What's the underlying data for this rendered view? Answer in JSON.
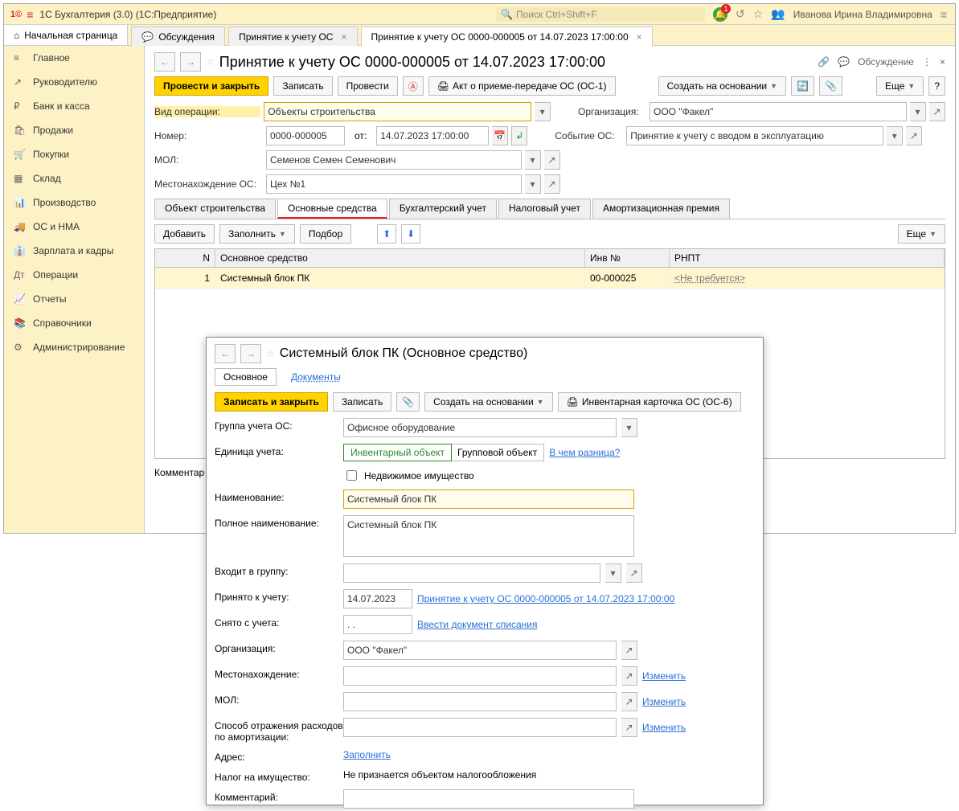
{
  "titlebar": {
    "app_title": "1С Бухгалтерия (3.0)  (1С:Предприятие)",
    "search_placeholder": "Поиск Ctrl+Shift+F",
    "notif_count": "1",
    "user_name": "Иванова Ирина Владимировна"
  },
  "tabs": {
    "home": "Начальная страница",
    "t1": "Обсуждения",
    "t2": "Принятие к учету ОС",
    "t3": "Принятие к учету ОС 0000-000005 от 14.07.2023 17:00:00"
  },
  "nav": {
    "items": [
      "Главное",
      "Руководителю",
      "Банк и касса",
      "Продажи",
      "Покупки",
      "Склад",
      "Производство",
      "ОС и НМА",
      "Зарплата и кадры",
      "Операции",
      "Отчеты",
      "Справочники",
      "Администрирование"
    ]
  },
  "doc": {
    "title": "Принятие к учету ОС 0000-000005 от 14.07.2023 17:00:00",
    "discuss": "Обсуждение",
    "btn_post_close": "Провести и закрыть",
    "btn_save": "Записать",
    "btn_post": "Провести",
    "btn_act": "Акт о приеме-передаче ОС (ОС-1)",
    "btn_create_based": "Создать на основании",
    "btn_more": "Еще",
    "lbl_vid": "Вид операции:",
    "val_vid": "Объекты строительства",
    "lbl_org": "Организация:",
    "val_org": "ООО \"Факел\"",
    "lbl_num": "Номер:",
    "val_num": "0000-000005",
    "lbl_ot": "от:",
    "val_date": "14.07.2023 17:00:00",
    "lbl_event": "Событие ОС:",
    "val_event": "Принятие к учету с вводом в эксплуатацию",
    "lbl_mol": "МОЛ:",
    "val_mol": "Семенов Семен Семенович",
    "lbl_loc": "Местонахождение ОС:",
    "val_loc": "Цех №1",
    "subtabs": [
      "Объект строительства",
      "Основные средства",
      "Бухгалтерский учет",
      "Налоговый учет",
      "Амортизационная премия"
    ],
    "btn_add": "Добавить",
    "btn_fill": "Заполнить",
    "btn_pick": "Подбор",
    "tbl_hdr": {
      "n": "N",
      "name": "Основное средство",
      "inv": "Инв №",
      "rnpt": "РНПТ"
    },
    "tbl_row": {
      "n": "1",
      "name": "Системный блок ПК",
      "inv": "00-000025",
      "rnpt": "<Не требуется>"
    },
    "lbl_comment": "Комментар"
  },
  "popup": {
    "title": "Системный блок ПК (Основное средство)",
    "tab_main": "Основное",
    "tab_docs": "Документы",
    "btn_save_close": "Записать и закрыть",
    "btn_save": "Записать",
    "btn_create_based": "Создать на основании",
    "btn_inv_card": "Инвентарная карточка ОС (ОС-6)",
    "lbl_group": "Группа учета ОС:",
    "val_group": "Офисное оборудование",
    "lbl_unit": "Единица учета:",
    "unit_opt1": "Инвентарный объект",
    "unit_opt2": "Групповой объект",
    "unit_link": "В чем разница?",
    "chk_realty": "Недвижимое имущество",
    "lbl_name": "Наименование:",
    "val_name": "Системный блок ПК",
    "lbl_fullname": "Полное наименование:",
    "val_fullname": "Системный блок ПК",
    "lbl_ingroup": "Входит в группу:",
    "lbl_accepted": "Принято к учету:",
    "val_accepted": "14.07.2023",
    "link_accepted": "Принятие к учету ОС 0000-000005 от 14.07.2023 17:00:00",
    "lbl_removed": "Снято с учета:",
    "val_removed": ".  .",
    "link_writeoff": "Ввести документ списания",
    "lbl_org": "Организация:",
    "val_org": "ООО \"Факел\"",
    "lbl_loc": "Местонахождение:",
    "link_change": "Изменить",
    "lbl_mol": "МОЛ:",
    "lbl_amort": "Способ отражения расходов по амортизации:",
    "lbl_addr": "Адрес:",
    "link_fill": "Заполнить",
    "lbl_tax": "Налог на имущество:",
    "val_tax": "Не признается объектом налогообложения",
    "lbl_comment": "Комментарий:"
  }
}
